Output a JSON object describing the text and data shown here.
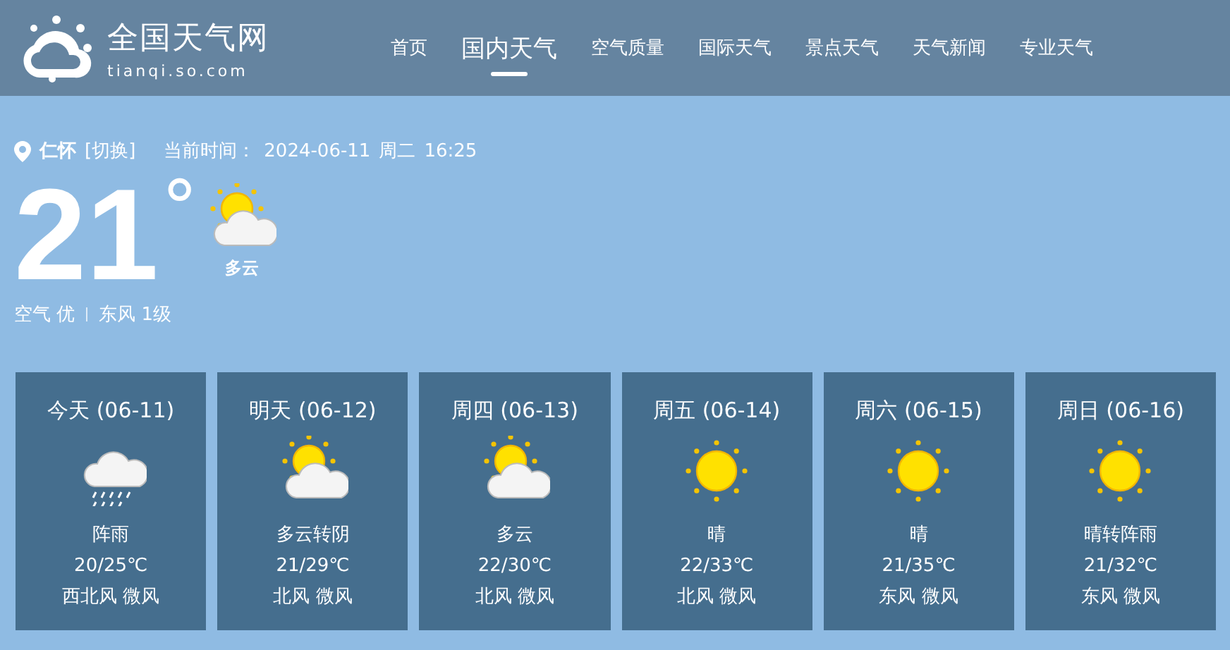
{
  "logo": {
    "name": "全国天气网",
    "domain": "tianqi.so.com"
  },
  "nav": [
    {
      "label": "首页",
      "selected": false
    },
    {
      "label": "国内天气",
      "selected": true
    },
    {
      "label": "空气质量",
      "selected": false
    },
    {
      "label": "国际天气",
      "selected": false
    },
    {
      "label": "景点天气",
      "selected": false
    },
    {
      "label": "天气新闻",
      "selected": false
    },
    {
      "label": "专业天气",
      "selected": false
    }
  ],
  "location": {
    "city": "仁怀",
    "switch": "[切换]",
    "time_label": "当前时间：",
    "date": "2024-06-11",
    "weekday": "周二",
    "time": "16:25"
  },
  "current": {
    "temperature": "21",
    "unit": "°",
    "kind": "partly-cloudy",
    "condition": "多云",
    "air": "空气 优",
    "wind": "东风 1级"
  },
  "forecast": [
    {
      "day": "今天 (06-11)",
      "kind": "rain",
      "condition": "阵雨",
      "temp": "20/25℃",
      "wind": "西北风 微风"
    },
    {
      "day": "明天 (06-12)",
      "kind": "partly-cloudy",
      "condition": "多云转阴",
      "temp": "21/29℃",
      "wind": "北风 微风"
    },
    {
      "day": "周四 (06-13)",
      "kind": "partly-cloudy",
      "condition": "多云",
      "temp": "22/30℃",
      "wind": "北风 微风"
    },
    {
      "day": "周五 (06-14)",
      "kind": "sunny",
      "condition": "晴",
      "temp": "22/33℃",
      "wind": "北风 微风"
    },
    {
      "day": "周六 (06-15)",
      "kind": "sunny",
      "condition": "晴",
      "temp": "21/35℃",
      "wind": "东风 微风"
    },
    {
      "day": "周日 (06-16)",
      "kind": "sunny",
      "condition": "晴转阵雨",
      "temp": "21/32℃",
      "wind": "东风 微风"
    }
  ]
}
